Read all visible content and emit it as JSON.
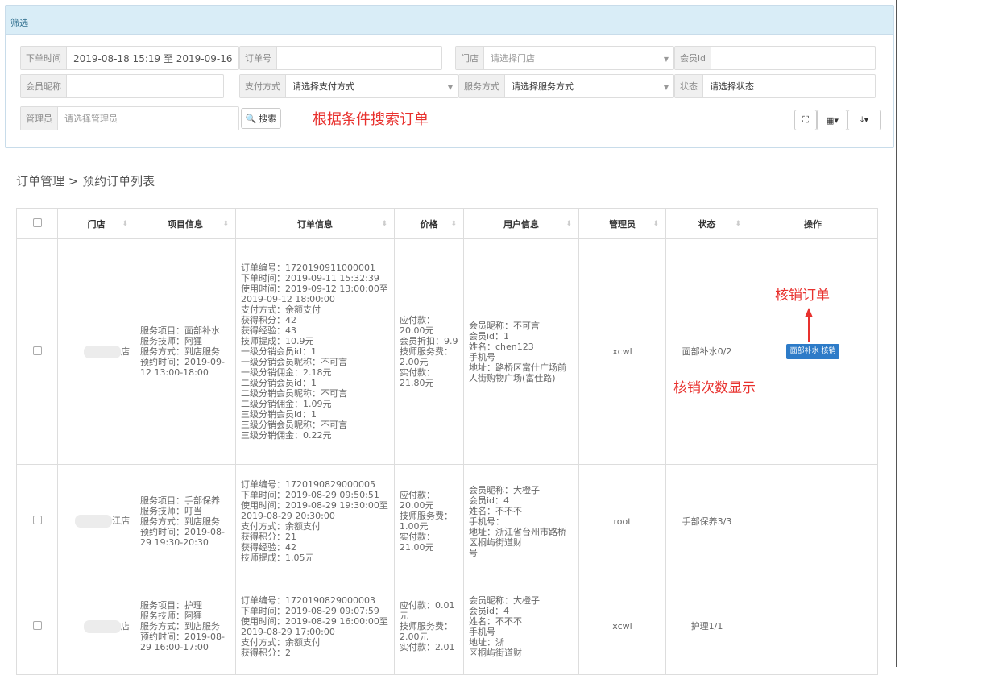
{
  "filter": {
    "title": "筛选",
    "order_time_label": "下单时间",
    "order_time_value": "2019-08-18 15:19 至 2019-09-16",
    "order_no_label": "订单号",
    "store_label": "门店",
    "store_placeholder": "请选择门店",
    "member_id_label": "会员id",
    "member_nick_label": "会员昵称",
    "pay_label": "支付方式",
    "pay_placeholder": "请选择支付方式",
    "service_label": "服务方式",
    "service_placeholder": "请选择服务方式",
    "status_label": "状态",
    "status_placeholder": "请选择状态",
    "admin_label": "管理员",
    "admin_placeholder": "请选择管理员",
    "search_button": "搜索"
  },
  "annotations": {
    "search": "根据条件搜索订单",
    "verify": "核销订单",
    "verify_count": "核销次数显示"
  },
  "breadcrumb": "订单管理 > 预约订单列表",
  "table": {
    "headers": [
      "门店",
      "项目信息",
      "订单信息",
      "价格",
      "用户信息",
      "管理员",
      "状态",
      "操作"
    ],
    "rows": [
      {
        "store": "店",
        "project": "服务项目：面部补水\n服务技师：阿狸\n服务方式：到店服务\n预约时间：2019-09-12 13:00-18:00",
        "order": "订单编号：1720190911000001\n下单时间：2019-09-11 15:32:39\n使用时间：2019-09-12 13:00:00至2019-09-12 18:00:00\n支付方式：余额支付\n获得积分：42\n获得经验：43\n技师提成：10.9元\n一级分销会员id：1\n一级分销会员昵称：不可言\n一级分销佣金：2.18元\n二级分销会员id：1\n二级分销会员昵称：不可言\n二级分销佣金：1.09元\n三级分销会员id：1\n三级分销会员昵称：不可言\n三级分销佣金：0.22元",
        "price": "应付款：20.00元\n会员折扣：9.9\n技师服务费：2.00元\n实付款：21.80元",
        "user": "会员昵称：不可言\n会员id：1\n姓名：chen123\n手机号\n地址：路桥区富仕广场前\n人街购物广场(富仕路)",
        "admin": "xcwl",
        "status": "面部补水0/2",
        "action": "面部补水 核销"
      },
      {
        "store": "江店",
        "project": "服务项目：手部保养\n服务技师：叮当\n服务方式：到店服务\n预约时间：2019-08-29 19:30-20:30",
        "order": "订单编号：1720190829000005\n下单时间：2019-08-29 09:50:51\n使用时间：2019-08-29 19:30:00至2019-08-29 20:30:00\n支付方式：余额支付\n获得积分：21\n获得经验：42\n技师提成：1.05元",
        "price": "应付款：20.00元\n技师服务费：1.00元\n实付款：21.00元",
        "user": "会员昵称：大橙子\n会员id：4\n姓名：不不不\n手机号：\n地址：浙江省台州市路桥区桐屿街道财\n号",
        "admin": "root",
        "status": "手部保养3/3",
        "action": ""
      },
      {
        "store": "店",
        "project": "服务项目：护理\n服务技师：阿狸\n服务方式：到店服务\n预约时间：2019-08-29 16:00-17:00",
        "order": "订单编号：1720190829000003\n下单时间：2019-08-29 09:07:59\n使用时间：2019-08-29 16:00:00至2019-08-29 17:00:00\n支付方式：余额支付\n获得积分：2",
        "price": "应付款：0.01元\n技师服务费：2.00元\n实付款：2.01",
        "user": "会员昵称：大橙子\n会员id：4\n姓名：不不不\n手机号\n地址：浙\n区桐屿街道财",
        "admin": "xcwl",
        "status": "护理1/1",
        "action": ""
      }
    ]
  }
}
